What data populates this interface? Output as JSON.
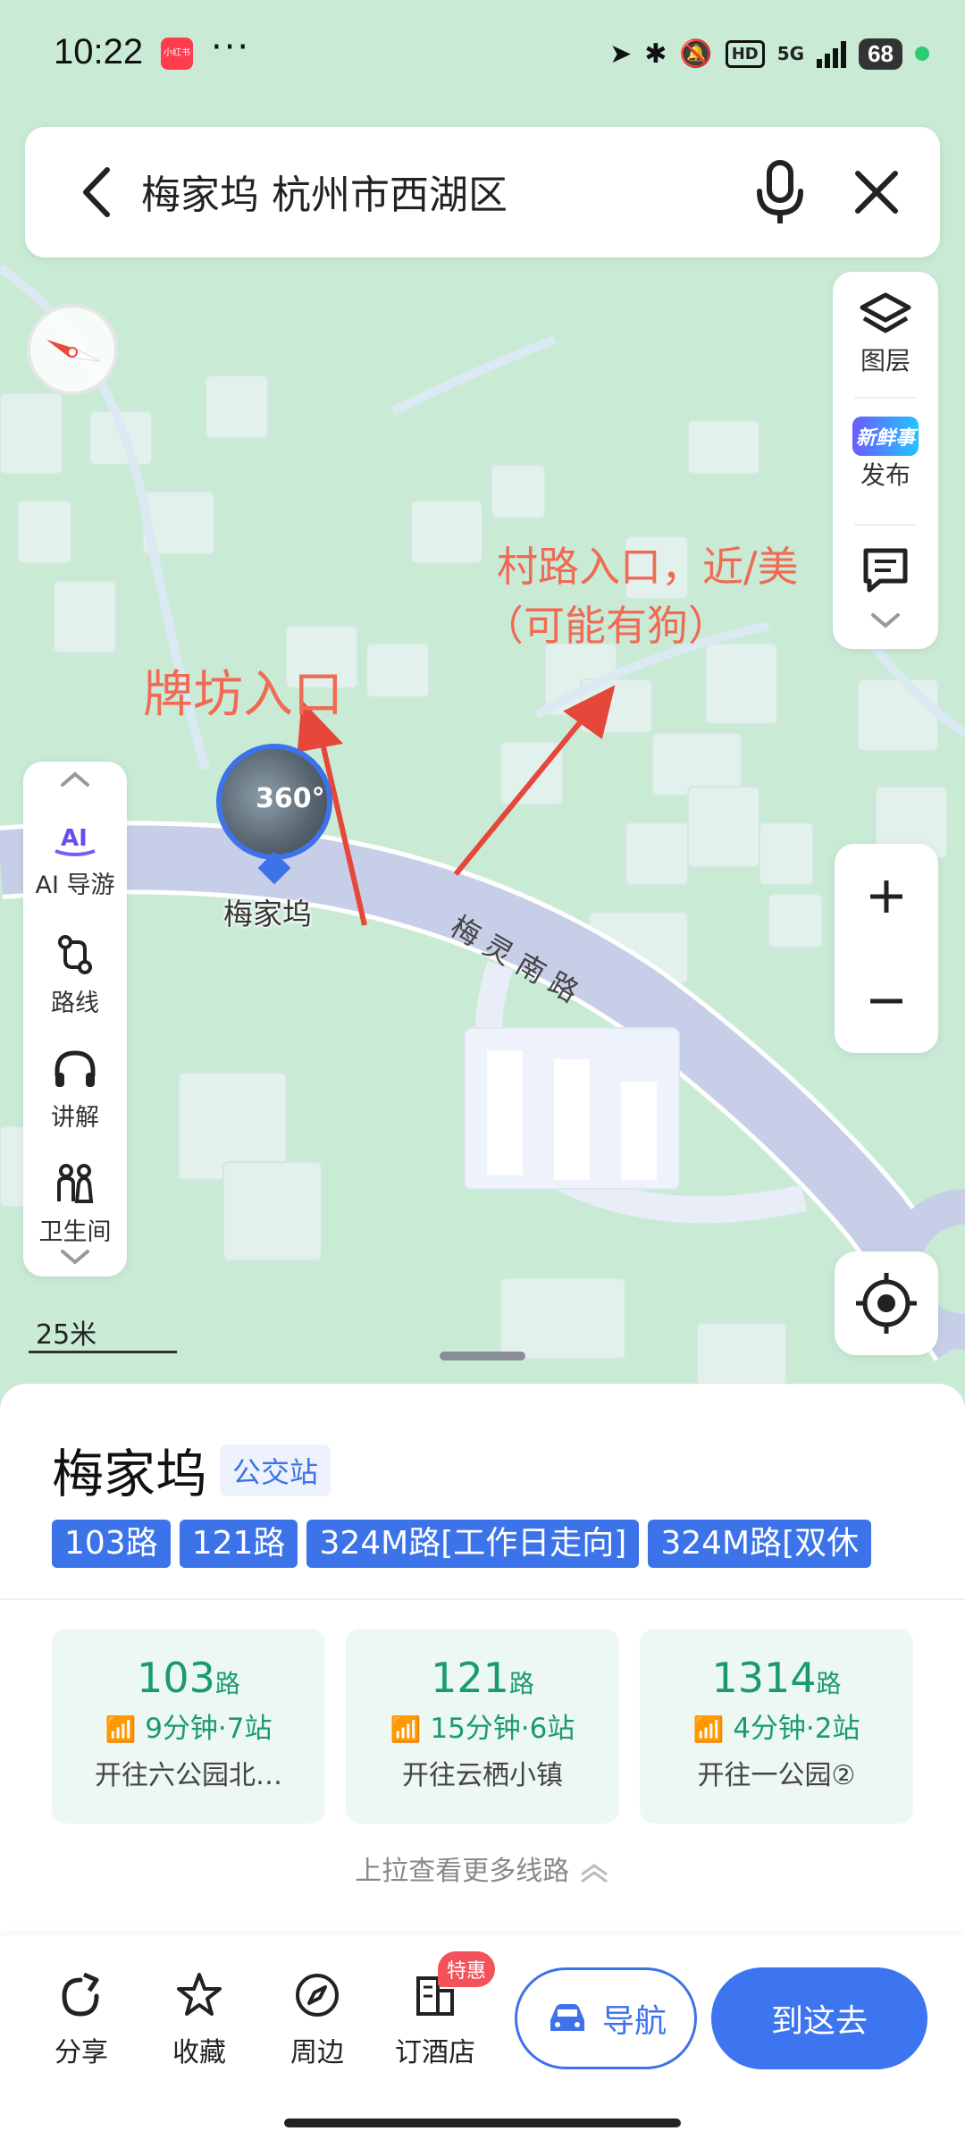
{
  "status_bar": {
    "time": "10:22",
    "app_badge": "小红书",
    "more": "···",
    "network": "5G",
    "hd": "HD",
    "battery": "68"
  },
  "search": {
    "query": "梅家坞 杭州市西湖区"
  },
  "right_panel": {
    "layers_label": "图层",
    "publish_badge": "新鲜事",
    "publish_label": "发布"
  },
  "left_panel": {
    "ai_label": "AI 导游",
    "route_label": "路线",
    "explain_label": "讲解",
    "toilet_label": "卫生间"
  },
  "map": {
    "poi_label": "梅家坞",
    "badge_360": "360°",
    "road_name": "梅灵南路",
    "scale_label": "25米",
    "annotation_left": "牌坊入口",
    "annotation_right_line1": "村路入口，近/美",
    "annotation_right_line2": "（可能有狗）"
  },
  "place": {
    "name": "梅家坞",
    "type_tag": "公交站",
    "routes": [
      "103路",
      "121路",
      "324M路[工作日走向]",
      "324M路[双休"
    ],
    "bus_cards": [
      {
        "number": "103",
        "unit": "路",
        "eta": "9分钟·7站",
        "direction": "开往六公园北…"
      },
      {
        "number": "121",
        "unit": "路",
        "eta": "15分钟·6站",
        "direction": "开往云栖小镇"
      },
      {
        "number": "1314",
        "unit": "路",
        "eta": "4分钟·2站",
        "direction": "开往一公园②"
      }
    ],
    "more_lines": "上拉查看更多线路"
  },
  "actions": {
    "share": "分享",
    "favorite": "收藏",
    "nearby": "周边",
    "hotel": "订酒店",
    "hotel_badge": "特惠",
    "navigate": "导航",
    "go_here": "到这去"
  },
  "colors": {
    "accent": "#3D74F0",
    "map_green": "#C9EBD6",
    "road": "#C7CFE8",
    "annotation": "#F06A54",
    "bus_green": "#1A9B6F"
  }
}
